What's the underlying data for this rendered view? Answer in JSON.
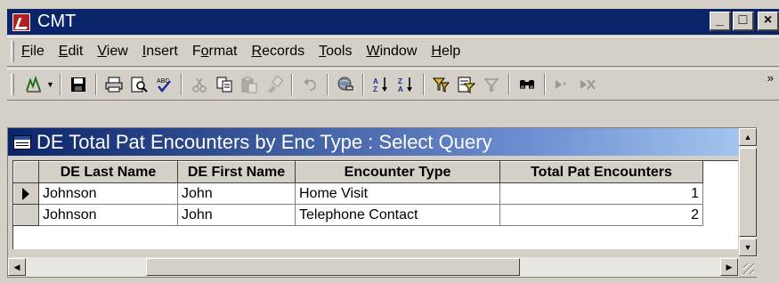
{
  "app": {
    "title": "CMT"
  },
  "window_buttons": {
    "minimize": "_",
    "maximize": "□",
    "close": "×"
  },
  "menu": [
    {
      "label": "File",
      "u": "F",
      "rest": "ile"
    },
    {
      "label": "Edit",
      "u": "E",
      "rest": "dit"
    },
    {
      "label": "View",
      "u": "V",
      "rest": "iew"
    },
    {
      "label": "Insert",
      "u": "I",
      "rest": "nsert"
    },
    {
      "label": "Format",
      "pre": "F",
      "u": "o",
      "rest": "rmat"
    },
    {
      "label": "Records",
      "u": "R",
      "rest": "ecords"
    },
    {
      "label": "Tools",
      "u": "T",
      "rest": "ools"
    },
    {
      "label": "Window",
      "u": "W",
      "rest": "indow"
    },
    {
      "label": "Help",
      "u": "H",
      "rest": "elp"
    }
  ],
  "toolbar": {
    "icons": [
      "design-view-icon",
      "save-icon",
      "print-icon",
      "print-preview-icon",
      "spelling-icon",
      "cut-icon",
      "copy-icon",
      "paste-icon",
      "format-painter-icon",
      "undo-icon",
      "insert-hyperlink-icon",
      "sort-ascending-icon",
      "sort-descending-icon",
      "filter-by-selection-icon",
      "filter-by-form-icon",
      "apply-filter-icon",
      "find-icon",
      "new-record-icon",
      "delete-record-icon"
    ],
    "chevron": "»"
  },
  "query_window": {
    "title": "DE Total Pat Encounters by Enc Type : Select Query",
    "columns": [
      "DE Last Name",
      "DE First Name",
      "Encounter Type",
      "Total Pat Encounters"
    ],
    "rows": [
      [
        "Johnson",
        "John",
        "Home Visit",
        "1"
      ],
      [
        "Johnson",
        "John",
        "Telephone Contact",
        "2"
      ]
    ]
  }
}
